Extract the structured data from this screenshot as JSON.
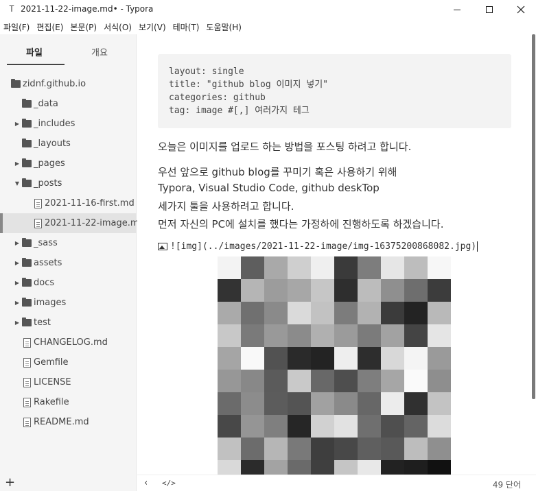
{
  "window": {
    "title": "2021-11-22-image.md• - Typora",
    "app_icon": "T"
  },
  "menu": [
    "파일(F)",
    "편집(E)",
    "본문(P)",
    "서식(O)",
    "보기(V)",
    "테마(T)",
    "도움말(H)"
  ],
  "sidebar": {
    "tabs": {
      "files": "파일",
      "outline": "개요"
    },
    "tree": [
      {
        "label": "zidnf.github.io",
        "type": "folder",
        "depth": 0,
        "arrow": ""
      },
      {
        "label": "_data",
        "type": "folder",
        "depth": 1,
        "arrow": ""
      },
      {
        "label": "_includes",
        "type": "folder",
        "depth": 1,
        "arrow": "▶"
      },
      {
        "label": "_layouts",
        "type": "folder",
        "depth": 1,
        "arrow": ""
      },
      {
        "label": "_pages",
        "type": "folder",
        "depth": 1,
        "arrow": "▶"
      },
      {
        "label": "_posts",
        "type": "folder",
        "depth": 1,
        "arrow": "▼"
      },
      {
        "label": "2021-11-16-first.md",
        "type": "file",
        "depth": 2,
        "arrow": ""
      },
      {
        "label": "2021-11-22-image.md",
        "type": "file",
        "depth": 2,
        "arrow": "",
        "active": true
      },
      {
        "label": "_sass",
        "type": "folder",
        "depth": 1,
        "arrow": "▶"
      },
      {
        "label": "assets",
        "type": "folder",
        "depth": 1,
        "arrow": "▶"
      },
      {
        "label": "docs",
        "type": "folder",
        "depth": 1,
        "arrow": "▶"
      },
      {
        "label": "images",
        "type": "folder",
        "depth": 1,
        "arrow": "▶"
      },
      {
        "label": "test",
        "type": "folder",
        "depth": 1,
        "arrow": "▶"
      },
      {
        "label": "CHANGELOG.md",
        "type": "file",
        "depth": 1,
        "arrow": ""
      },
      {
        "label": "Gemfile",
        "type": "file",
        "depth": 1,
        "arrow": ""
      },
      {
        "label": "LICENSE",
        "type": "file",
        "depth": 1,
        "arrow": ""
      },
      {
        "label": "Rakefile",
        "type": "file",
        "depth": 1,
        "arrow": ""
      },
      {
        "label": "README.md",
        "type": "file",
        "depth": 1,
        "arrow": ""
      }
    ],
    "add_label": "+"
  },
  "editor": {
    "frontmatter": [
      "layout: single",
      "title: \"github blog 이미지 넣기\"",
      "categories: github",
      "tag: image #[,] 여러가지 테그"
    ],
    "paragraph1": "오늘은 이미지를 업로드 하는 방법을 포스팅 하려고 합니다.",
    "paragraph2": [
      "우선 앞으로 github blog를 꾸미기 혹은 사용하기 위해",
      "Typora, Visual Studio Code, github deskTop",
      "세가지 툴을 사용하려고 합니다.",
      "먼저 자신의 PC에 설치를 했다는 가정하에 진행하도록 하겠습니다."
    ],
    "image_markdown": "![img](../images/2021-11-22-image/img-16375200868082.jpg)",
    "image_grays": [
      "#f3f3f3",
      "#5e5e5e",
      "#a9a9a9",
      "#cfcfcf",
      "#efefef",
      "#3a3a3a",
      "#7d7d7d",
      "#e6e6e6",
      "#bdbdbd",
      "#f7f7f7",
      "#333333",
      "#b5b5b5",
      "#9c9c9c",
      "#a7a7a7",
      "#c6c6c6",
      "#2e2e2e",
      "#bcbcbc",
      "#8f8f8f",
      "#6e6e6e",
      "#3c3c3c",
      "#aaaaaa",
      "#707070",
      "#8a8a8a",
      "#dadada",
      "#c2c2c2",
      "#7c7c7c",
      "#b2b2b2",
      "#3b3b3b",
      "#232323",
      "#b9b9b9",
      "#c8c8c8",
      "#7a7a7a",
      "#999999",
      "#8b8b8b",
      "#b0b0b0",
      "#9b9b9b",
      "#7b7b7b",
      "#a2a2a2",
      "#444444",
      "#e5e5e5",
      "#a5a5a5",
      "#f9f9f9",
      "#525252",
      "#2a2a2a",
      "#232323",
      "#eeeeee",
      "#2d2d2d",
      "#d8d8d8",
      "#f4f4f4",
      "#9a9a9a",
      "#979797",
      "#888888",
      "#5b5b5b",
      "#c9c9c9",
      "#686868",
      "#4e4e4e",
      "#7e7e7e",
      "#a6a6a6",
      "#fafafa",
      "#8e8e8e",
      "#6b6b6b",
      "#8c8c8c",
      "#5c5c5c",
      "#545454",
      "#a1a1a1",
      "#8a8a8a",
      "#676767",
      "#ececec",
      "#303030",
      "#c3c3c3",
      "#484848",
      "#959595",
      "#7f7f7f",
      "#262626",
      "#d1d1d1",
      "#e2e2e2",
      "#6f6f6f",
      "#4f4f4f",
      "#646464",
      "#dcdcdc",
      "#c1c1c1",
      "#6c6c6c",
      "#b6b6b6",
      "#797979",
      "#3e3e3e",
      "#484848",
      "#5f5f5f",
      "#595959",
      "#bdbdbd",
      "#8f8f8f",
      "#d9d9d9",
      "#2b2b2b",
      "#a3a3a3",
      "#6a6a6a",
      "#3f3f3f",
      "#c5c5c5",
      "#e8e8e8",
      "#222222",
      "#1e1e1e",
      "#111111"
    ]
  },
  "status": {
    "back_label": "‹",
    "source_label": "</>",
    "word_count": "49 단어"
  }
}
